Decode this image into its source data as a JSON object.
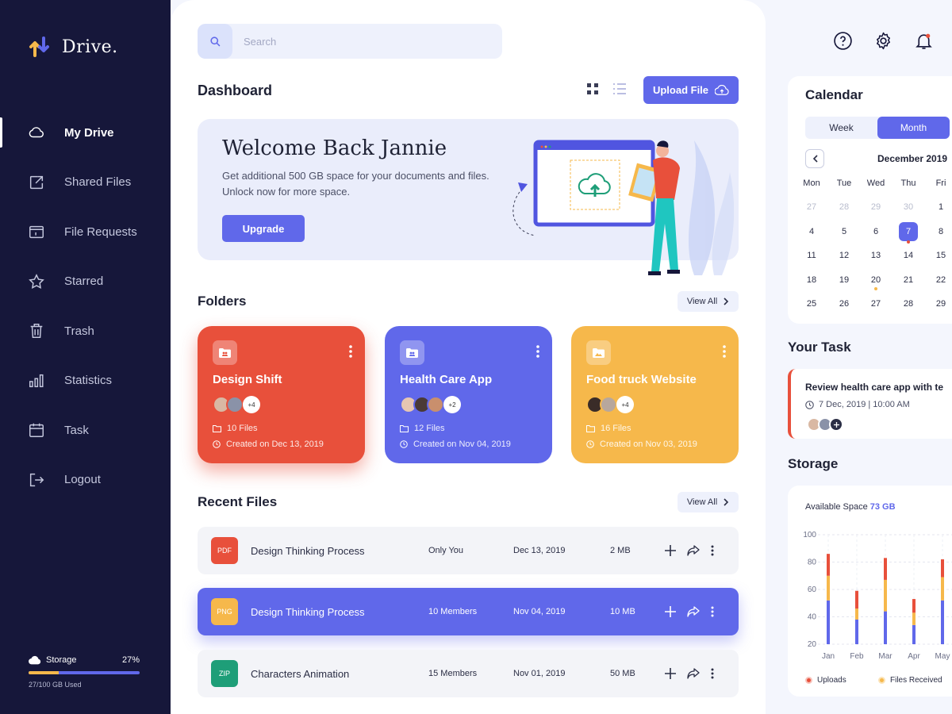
{
  "brand": {
    "name": "Drive."
  },
  "sidebar": {
    "items": [
      {
        "label": "My Drive",
        "icon": "cloud-icon",
        "active": true
      },
      {
        "label": "Shared Files",
        "icon": "share-icon",
        "active": false
      },
      {
        "label": "File Requests",
        "icon": "folder-request-icon",
        "active": false
      },
      {
        "label": "Starred",
        "icon": "star-icon",
        "active": false
      },
      {
        "label": "Trash",
        "icon": "trash-icon",
        "active": false
      },
      {
        "label": "Statistics",
        "icon": "chart-icon",
        "active": false
      },
      {
        "label": "Task",
        "icon": "calendar-icon",
        "active": false
      },
      {
        "label": "Logout",
        "icon": "logout-icon",
        "active": false
      }
    ],
    "storage": {
      "label": "Storage",
      "percent": "27%",
      "fraction": 0.27,
      "used": "27/100 GB Used"
    }
  },
  "search": {
    "placeholder": "Search"
  },
  "dashboard": {
    "title": "Dashboard",
    "upload_label": "Upload File",
    "banner": {
      "title": "Welcome Back Jannie",
      "text": "Get additional 500 GB space for your documents and files. Unlock now for more space.",
      "button": "Upgrade"
    }
  },
  "folders": {
    "title": "Folders",
    "view_all": "View All",
    "items": [
      {
        "name": "Design Shift",
        "more": "+4",
        "files": "10 Files",
        "created": "Created on Dec 13, 2019",
        "color": "#e8503b"
      },
      {
        "name": "Health Care App",
        "more": "+2",
        "files": "12 Files",
        "created": "Created on Nov 04, 2019",
        "color": "#6068ea"
      },
      {
        "name": "Food truck Website",
        "more": "+4",
        "files": "16 Files",
        "created": "Created on Nov 03, 2019",
        "color": "#f6b84b"
      }
    ]
  },
  "recent": {
    "title": "Recent Files",
    "view_all": "View All",
    "files": [
      {
        "type": "PDF",
        "name": "Design Thinking Process",
        "members": "Only You",
        "date": "Dec 13, 2019",
        "size": "2 MB",
        "badge_color": "#e8503b"
      },
      {
        "type": "PNG",
        "name": "Design Thinking Process",
        "members": "10 Members",
        "date": "Nov 04, 2019",
        "size": "10 MB",
        "badge_color": "#f6b84b"
      },
      {
        "type": "ZIP",
        "name": "Characters Animation",
        "members": "15 Members",
        "date": "Nov 01, 2019",
        "size": "50 MB",
        "badge_color": "#1e9e78"
      }
    ]
  },
  "calendar": {
    "title": "Calendar",
    "tabs": [
      "Week",
      "Month"
    ],
    "active_tab": "Month",
    "month": "December 2019",
    "weekdays": [
      "Mon",
      "Tue",
      "Wed",
      "Thu",
      "Fri"
    ],
    "weeks": [
      [
        "27",
        "28",
        "29",
        "30",
        "1"
      ],
      [
        "4",
        "5",
        "6",
        "7",
        "8"
      ],
      [
        "11",
        "12",
        "13",
        "14",
        "15"
      ],
      [
        "18",
        "19",
        "20",
        "21",
        "22"
      ],
      [
        "25",
        "26",
        "27",
        "28",
        "29"
      ]
    ],
    "selected": "7"
  },
  "task": {
    "title": "Your Task",
    "name": "Review health care app with te",
    "time": "7 Dec, 2019  |  10:00 AM"
  },
  "storage": {
    "title": "Storage",
    "available_label": "Available Space",
    "available_value": "73 GB",
    "legend": [
      "Uploads",
      "Files Received"
    ]
  },
  "chart_data": {
    "type": "bar",
    "categories": [
      "Jan",
      "Feb",
      "Mar",
      "Apr",
      "May"
    ],
    "ylim": [
      20,
      100
    ],
    "yticks": [
      100,
      80,
      60,
      40,
      20
    ],
    "series": [
      {
        "name": "Uploads",
        "color": "#e8503b",
        "values": [
          16,
          13,
          16,
          10,
          13
        ]
      },
      {
        "name": "Files Received",
        "color": "#f6b84b",
        "values": [
          18,
          8,
          23,
          9,
          17
        ]
      },
      {
        "name": "",
        "color": "#6068ea",
        "values": [
          32,
          18,
          24,
          14,
          32
        ]
      }
    ],
    "colors": {
      "accent": "#6068ea",
      "red": "#e8503b",
      "yellow": "#f6b84b",
      "sidebar": "#16173a"
    }
  }
}
